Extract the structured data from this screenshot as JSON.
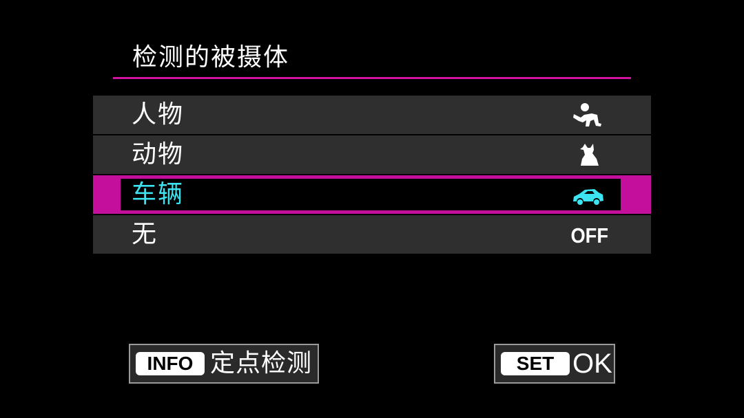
{
  "title": "检测的被摄体",
  "accent_color": "#c40e9c",
  "selected_text_color": "#3ce4f2",
  "options": [
    {
      "label": "人物",
      "icon": "person-icon",
      "selected": false
    },
    {
      "label": "动物",
      "icon": "animal-icon",
      "selected": false
    },
    {
      "label": "车辆",
      "icon": "vehicle-icon",
      "selected": true
    },
    {
      "label": "无",
      "value": "OFF",
      "selected": false
    }
  ],
  "footer": {
    "info_key": "INFO",
    "info_label": "定点检测",
    "set_key": "SET",
    "set_label": "OK"
  }
}
